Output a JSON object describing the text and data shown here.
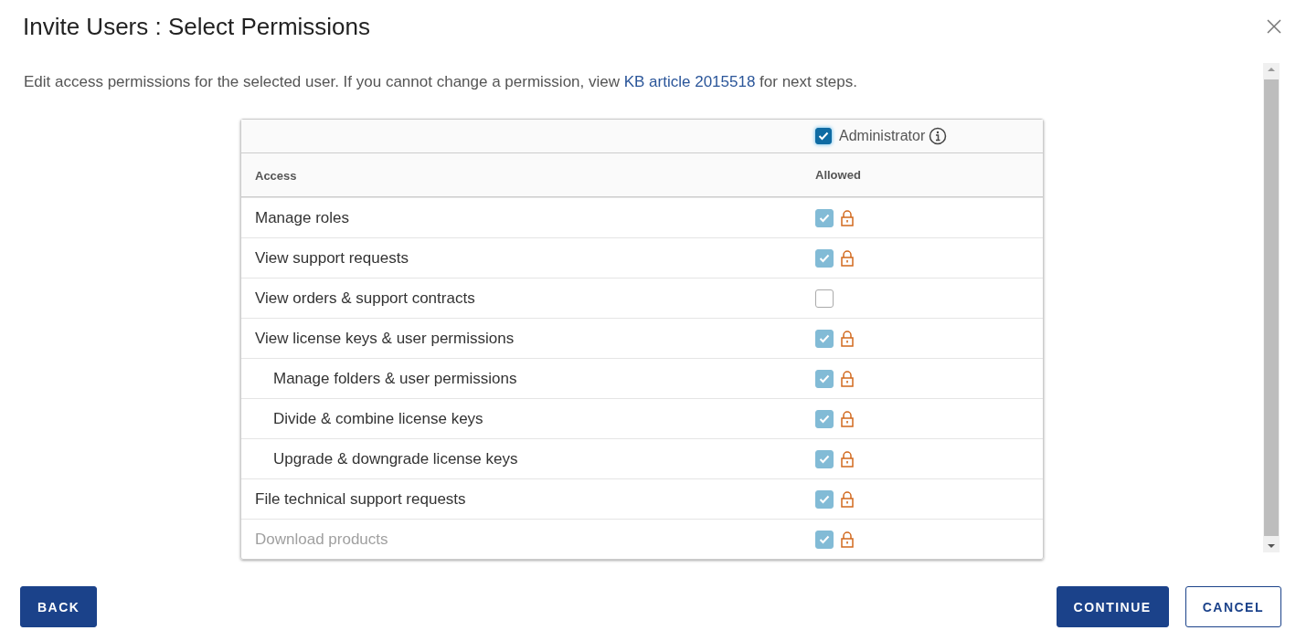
{
  "dialog": {
    "title": "Invite Users : Select Permissions"
  },
  "description": {
    "before": "Edit access permissions for the selected user. If you cannot change a permission, view ",
    "link": "KB article 2015518",
    "after": " for next steps."
  },
  "table": {
    "administrator": {
      "label": "Administrator",
      "checked": true
    },
    "columns": [
      "Access",
      "Allowed"
    ],
    "rows": [
      {
        "label": "Manage roles",
        "checked": true,
        "locked": true,
        "disabled": false
      },
      {
        "label": "View support requests",
        "checked": true,
        "locked": true,
        "disabled": false
      },
      {
        "label": "View orders & support contracts",
        "checked": false,
        "locked": false,
        "disabled": false
      },
      {
        "label": "View license keys & user permissions",
        "checked": true,
        "locked": true,
        "disabled": false,
        "children": [
          {
            "label": "Manage folders & user permissions",
            "checked": true,
            "locked": true,
            "disabled": false
          },
          {
            "label": "Divide & combine license keys",
            "checked": true,
            "locked": true,
            "disabled": false
          },
          {
            "label": "Upgrade & downgrade license keys",
            "checked": true,
            "locked": true,
            "disabled": false
          }
        ]
      },
      {
        "label": "File technical support requests",
        "checked": true,
        "locked": true,
        "disabled": false
      },
      {
        "label": "Download products",
        "checked": true,
        "locked": true,
        "disabled": true
      }
    ]
  },
  "buttons": {
    "back": "BACK",
    "continue": "CONTINUE",
    "cancel": "CANCEL"
  }
}
